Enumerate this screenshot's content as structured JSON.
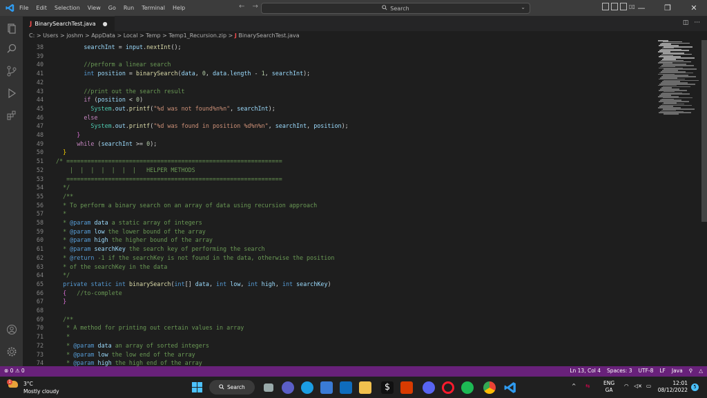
{
  "titlebar": {
    "menu": [
      "File",
      "Edit",
      "Selection",
      "View",
      "Go",
      "Run",
      "Terminal",
      "Help"
    ],
    "nav": "← →",
    "search": "Search",
    "window_controls": [
      "—",
      "❐",
      "✕"
    ]
  },
  "tab": {
    "icon": "J",
    "label": "BinarySearchTest.java",
    "modified": "●"
  },
  "tab_actions": [
    "◫",
    "···"
  ],
  "breadcrumb": {
    "path": "C: > Users > joshm > AppData > Local > Temp > Temp1_Recursion.zip >",
    "icon": "J",
    "file": "BinarySearchTest.java"
  },
  "code": [
    {
      "n": "38",
      "html": "        <span class='vr'>searchInt</span> <span class='pl'>=</span> <span class='vr'>input</span>.<span class='fn'>nextInt</span>();"
    },
    {
      "n": "39",
      "html": ""
    },
    {
      "n": "40",
      "html": "        <span class='cm'>//perform a linear search</span>"
    },
    {
      "n": "41",
      "html": "        <span class='kw'>int</span> <span class='vr'>position</span> = <span class='fn'>binarySearch</span>(<span class='vr'>data</span>, <span class='nm'>0</span>, <span class='vr'>data</span>.<span class='vr'>length</span> - <span class='nm'>1</span>, <span class='vr'>searchInt</span>);"
    },
    {
      "n": "42",
      "html": ""
    },
    {
      "n": "43",
      "html": "        <span class='cm'>//print out the search result</span>"
    },
    {
      "n": "44",
      "html": "        <span class='ctl'>if</span> (<span class='vr'>position</span> &lt; <span class='nm'>0</span>)"
    },
    {
      "n": "45",
      "html": "          <span class='ty'>System</span>.<span class='vr'>out</span>.<span class='fn'>printf</span>(<span class='st'>\"%d was not found%n%n\"</span>, <span class='vr'>searchInt</span>);"
    },
    {
      "n": "46",
      "html": "        <span class='ctl'>else</span>"
    },
    {
      "n": "47",
      "html": "          <span class='ty'>System</span>.<span class='vr'>out</span>.<span class='fn'>printf</span>(<span class='st'>\"%d was found in position %d%n%n\"</span>, <span class='vr'>searchInt</span>, <span class='vr'>position</span>);"
    },
    {
      "n": "48",
      "html": "      <span class='br2'>}</span>"
    },
    {
      "n": "49",
      "html": "      <span class='ctl'>while</span> (<span class='vr'>searchInt</span> &gt;= <span class='nm'>0</span>);"
    },
    {
      "n": "50",
      "html": "  <span class='br'>}</span>"
    },
    {
      "n": "51",
      "html": "<span class='cm'>/* ==============================================================</span>"
    },
    {
      "n": "52",
      "html": "<span class='cm'>    |  |  |  |  |  |  |   HELPER METHODS</span>"
    },
    {
      "n": "53",
      "html": "<span class='cm'>   ==============================================================</span>"
    },
    {
      "n": "54",
      "html": "<span class='cm'>  */</span>"
    },
    {
      "n": "55",
      "html": "<span class='cm'>  /**</span>"
    },
    {
      "n": "56",
      "html": "<span class='cm'>  * To perform a binary search on an array of data using recursion approach</span>"
    },
    {
      "n": "57",
      "html": "<span class='cm'>  *</span>"
    },
    {
      "n": "58",
      "html": "<span class='cm'>  * </span><span class='tag'>@param</span> <span class='vr'>data</span><span class='cm'> a static array of integers</span>"
    },
    {
      "n": "59",
      "html": "<span class='cm'>  * </span><span class='tag'>@param</span> <span class='vr'>low</span><span class='cm'> the lower bound of the array</span>"
    },
    {
      "n": "60",
      "html": "<span class='cm'>  * </span><span class='tag'>@param</span> <span class='vr'>high</span><span class='cm'> the higher bound of the array</span>"
    },
    {
      "n": "61",
      "html": "<span class='cm'>  * </span><span class='tag'>@param</span> <span class='vr'>searchKey</span><span class='cm'> the search key of performing the search</span>"
    },
    {
      "n": "62",
      "html": "<span class='cm'>  * </span><span class='tag'>@return</span><span class='cm'> -1 if the searchKey is not found in the data, otherwise the position</span>"
    },
    {
      "n": "63",
      "html": "<span class='cm'>  * of the searchKey in the data</span>"
    },
    {
      "n": "64",
      "html": "<span class='cm'>  */</span>"
    },
    {
      "n": "65",
      "html": "  <span class='kw'>private</span> <span class='kw'>static</span> <span class='kw'>int</span> <span class='fn'>binarySearch</span>(<span class='kw'>int</span>[] <span class='vr'>data</span>, <span class='kw'>int</span> <span class='vr'>low</span>, <span class='kw'>int</span> <span class='vr'>high</span>, <span class='kw'>int</span> <span class='vr'>searchKey</span>)"
    },
    {
      "n": "66",
      "html": "  <span class='br2'>{</span>   <span class='cm'>//to-complete</span>"
    },
    {
      "n": "67",
      "html": "  <span class='br2'>}</span>"
    },
    {
      "n": "68",
      "html": ""
    },
    {
      "n": "69",
      "html": "<span class='cm'>  /**</span>"
    },
    {
      "n": "70",
      "html": "<span class='cm'>   * A method for printing out certain values in array</span>"
    },
    {
      "n": "71",
      "html": "<span class='cm'>   *</span>"
    },
    {
      "n": "72",
      "html": "<span class='cm'>   * </span><span class='tag'>@param</span> <span class='vr'>data</span><span class='cm'> an array of sorted integers</span>"
    },
    {
      "n": "73",
      "html": "<span class='cm'>   * </span><span class='tag'>@param</span> <span class='vr'>low</span><span class='cm'> the low end of the array</span>"
    },
    {
      "n": "74",
      "html": "<span class='cm'>   * </span><span class='tag'>@param</span> <span class='vr'>high</span><span class='cm'> the high end of the array</span>"
    }
  ],
  "status": {
    "problems": "⊗ 0 ⚠ 0",
    "right": [
      "Ln 13, Col 4",
      "Spaces: 3",
      "UTF-8",
      "LF",
      "Java",
      "♫",
      "🔔"
    ]
  },
  "taskbar": {
    "weather_temp": "3°C",
    "weather_desc": "Mostly cloudy",
    "search": "Search",
    "lang1": "ENG",
    "lang2": "GA",
    "time": "12:01",
    "date": "08/12/2022",
    "notification_count": "5",
    "weather_badge": "1"
  },
  "colors": {
    "statusbar": "#68217a",
    "accent": "#0078d4"
  }
}
